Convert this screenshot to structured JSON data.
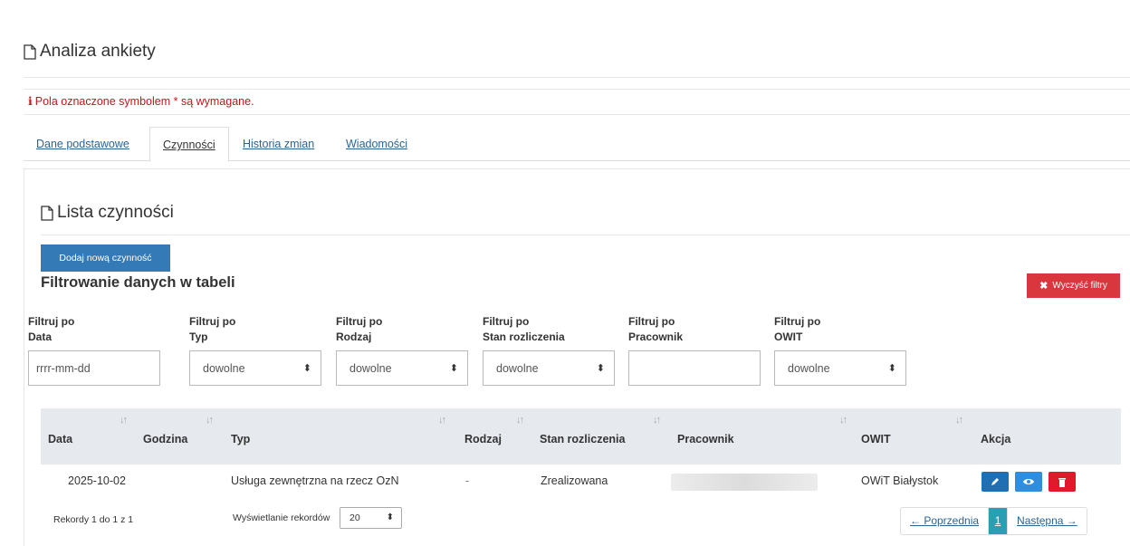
{
  "page": {
    "title": "Analiza ankiety"
  },
  "required_note": {
    "icon": "info-icon",
    "text": "Pola oznaczone symbolem * są wymagane."
  },
  "tabs": [
    {
      "label": "Dane podstawowe",
      "active": false
    },
    {
      "label": "Czynności",
      "active": true
    },
    {
      "label": "Historia zmian",
      "active": false
    },
    {
      "label": "Wiadomości",
      "active": false
    }
  ],
  "section": {
    "title": "Lista czynności"
  },
  "buttons": {
    "add": "Dodaj nową czynność",
    "clear": "Wyczyść filtry"
  },
  "filter_heading": "Filtrowanie danych w tabeli",
  "filters": [
    {
      "line1": "Filtruj po",
      "line2": "Data",
      "kind": "input",
      "placeholder": "rrrr-mm-dd",
      "value": ""
    },
    {
      "line1": "Filtruj po",
      "line2": "Typ",
      "kind": "select",
      "value": "dowolne"
    },
    {
      "line1": "Filtruj po",
      "line2": "Rodzaj",
      "kind": "select",
      "value": "dowolne"
    },
    {
      "line1": "Filtruj po",
      "line2": "Stan rozliczenia",
      "kind": "select",
      "value": "dowolne"
    },
    {
      "line1": "Filtruj po",
      "line2": "Pracownik",
      "kind": "input",
      "placeholder": "",
      "value": ""
    },
    {
      "line1": "Filtruj po",
      "line2": "OWIT",
      "kind": "select",
      "value": "dowolne"
    }
  ],
  "table": {
    "columns": [
      "Data",
      "Godzina",
      "Typ",
      "Rodzaj",
      "Stan rozliczenia",
      "Pracownik",
      "OWIT",
      "Akcja"
    ],
    "rows": [
      {
        "data": "2025-10-02",
        "godzina": "",
        "typ": "Usługa zewnętrzna na rzecz OzN",
        "rodzaj": "-",
        "stan": "Zrealizowana",
        "pracownik": "",
        "owit": "OWiT Białystok"
      }
    ]
  },
  "footer": {
    "records_info": "Rekordy 1 do 1 z 1",
    "length_label": "Wyświetlanie rekordów",
    "length_value": "20",
    "pagination": {
      "prev": "← Poprzednia",
      "current": "1",
      "next": "Następna →"
    }
  },
  "colors": {
    "primary": "#337ab7",
    "danger": "#d9363e",
    "page_active": "#2a9fb3",
    "link": "#2a6496",
    "required": "#c0161b"
  }
}
